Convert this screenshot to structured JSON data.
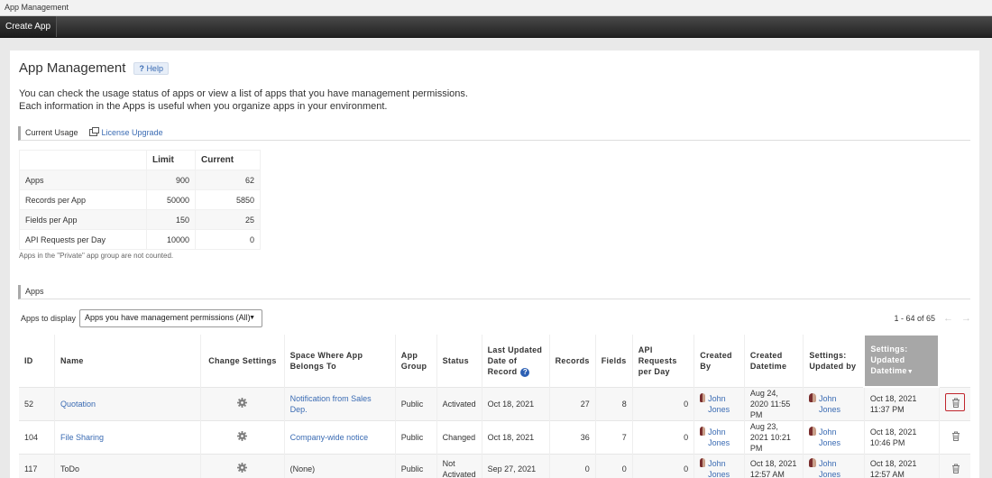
{
  "window": {
    "title": "App Management"
  },
  "toolbar": {
    "create_app": "Create App"
  },
  "page": {
    "title": "App Management",
    "help_label": "Help",
    "desc_line1": "You can check the usage status of apps or view a list of apps that you have management permissions.",
    "desc_line2": "Each information in the Apps is useful when you organize apps in your environment."
  },
  "usage": {
    "section_title": "Current Usage",
    "license_link": "License Upgrade",
    "col_limit": "Limit",
    "col_current": "Current",
    "rows": [
      {
        "label": "Apps",
        "limit": "900",
        "current": "62"
      },
      {
        "label": "Records per App",
        "limit": "50000",
        "current": "5850"
      },
      {
        "label": "Fields per App",
        "limit": "150",
        "current": "25"
      },
      {
        "label": "API Requests per Day",
        "limit": "10000",
        "current": "0"
      }
    ],
    "note": "Apps in the \"Private\" app group are not counted."
  },
  "apps": {
    "section_title": "Apps",
    "filter_label": "Apps to display",
    "filter_value": "Apps you have management permissions (All)",
    "pager_text": "1 - 64 of 65",
    "headers": {
      "id": "ID",
      "name": "Name",
      "change_settings": "Change Settings",
      "space": "Space Where App Belongs To",
      "app_group": "App Group",
      "status": "Status",
      "last_updated": "Last Updated Date of Record",
      "records": "Records",
      "fields": "Fields",
      "api": "API Requests per Day",
      "created_by": "Created By",
      "created_datetime": "Created Datetime",
      "settings_updated_by": "Settings: Updated by",
      "settings_updated_datetime": "Settings: Updated Datetime"
    },
    "rows": [
      {
        "id": "52",
        "name": "Quotation",
        "space": "Notification from Sales Dep.",
        "space_link": true,
        "group": "Public",
        "status": "Activated",
        "last_updated": "Oct 18, 2021",
        "records": "27",
        "fields": "8",
        "api": "0",
        "created_by": "John Jones",
        "created": "Aug 24, 2020 11:55 PM",
        "updated_by": "John Jones",
        "updated": "Oct 18, 2021 11:37 PM"
      },
      {
        "id": "104",
        "name": "File Sharing",
        "space": "Company-wide notice",
        "space_link": true,
        "group": "Public",
        "status": "Changed",
        "last_updated": "Oct 18, 2021",
        "records": "36",
        "fields": "7",
        "api": "0",
        "created_by": "John Jones",
        "created": "Aug 23, 2021 10:21 PM",
        "updated_by": "John Jones",
        "updated": "Oct 18, 2021 10:46 PM"
      },
      {
        "id": "117",
        "name": "ToDo",
        "space": "(None)",
        "space_link": false,
        "group": "Public",
        "status": "Not Activated",
        "last_updated": "Sep 27, 2021",
        "records": "0",
        "fields": "0",
        "api": "0",
        "created_by": "John Jones",
        "created": "Oct 18, 2021 12:57 AM",
        "updated_by": "John Jones",
        "updated": "Oct 18, 2021 12:57 AM"
      }
    ]
  },
  "colors": {
    "link": "#3a6bb3",
    "highlight": "#c0262d",
    "active_header": "#a7a7a7"
  },
  "icons": {
    "help": "question-icon",
    "license": "window-icon",
    "settings": "gear-icon",
    "delete": "trash-icon",
    "user": "avatar-icon"
  }
}
